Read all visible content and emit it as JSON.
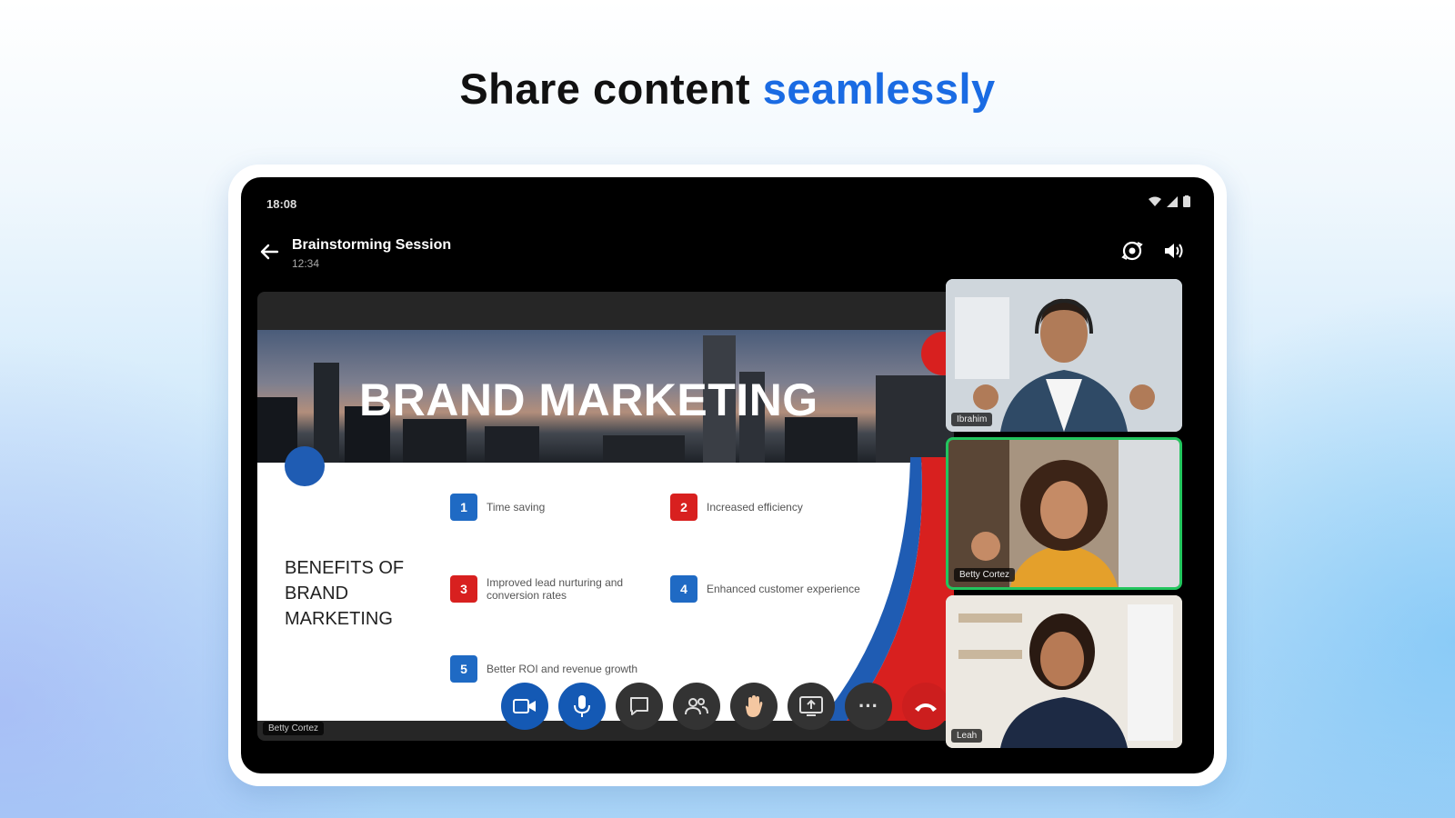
{
  "headline": {
    "prefix": "Share content",
    "highlight": "seamlessly"
  },
  "status_bar": {
    "time": "18:08"
  },
  "meeting": {
    "title": "Brainstorming Session",
    "duration": "12:34"
  },
  "slide": {
    "title": "BRAND MARKETING",
    "benefits_heading": "BENEFITS OF BRAND MARKETING",
    "items": [
      {
        "number": "1",
        "text": "Time saving"
      },
      {
        "number": "2",
        "text": "Increased efficiency"
      },
      {
        "number": "3",
        "text": "Improved lead nurturing and conversion rates"
      },
      {
        "number": "4",
        "text": "Enhanced customer experience"
      },
      {
        "number": "5",
        "text": "Better ROI and revenue growth"
      }
    ]
  },
  "presenter": "Betty Cortez",
  "participants": [
    {
      "name": "Ibrahim",
      "speaking": false
    },
    {
      "name": "Betty Cortez",
      "speaking": true
    },
    {
      "name": "Leah",
      "speaking": false
    }
  ],
  "controls": {
    "more_label": "···"
  },
  "colors": {
    "accent": "#1a6be3",
    "active_button": "#1459b4",
    "end_call": "#cc1e1e",
    "speaking": "#22c55e",
    "slide_red": "#d8201f",
    "slide_blue": "#1f6ac4"
  },
  "icons": [
    "back-arrow-icon",
    "camera-switch-icon",
    "speaker-icon",
    "video-camera-icon",
    "microphone-icon",
    "chat-icon",
    "participants-icon",
    "raise-hand-icon",
    "share-screen-icon",
    "more-icon",
    "end-call-icon",
    "wifi-icon",
    "signal-icon",
    "battery-icon"
  ]
}
